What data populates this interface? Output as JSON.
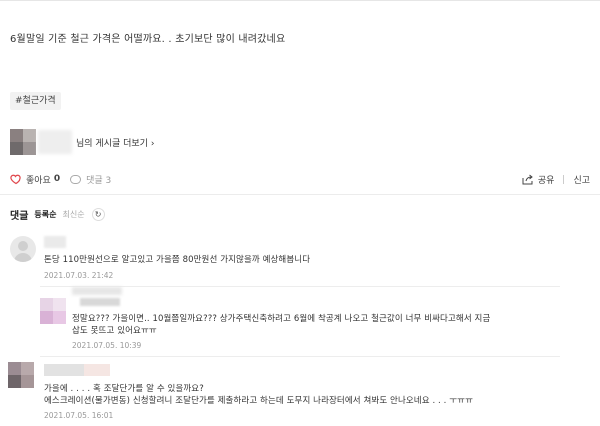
{
  "post": {
    "body": "6월말일 기준 철근 가격은 어떨까요. .   초기보단 많이 내려갔네요",
    "tag": "#철근가격",
    "author_more": "님의 게시글 더보기 ›"
  },
  "actions": {
    "like_label": "좋아요",
    "like_count": "0",
    "comment_label": "댓글 3",
    "share_label": "공유",
    "report_label": "신고"
  },
  "comments": {
    "title": "댓글",
    "sort_active": "등록순",
    "sort_inactive": "최신순",
    "refresh_glyph": "↻",
    "items": [
      {
        "text": "톤당 110만원선으로 알고있고 가을쯤 80만원선 가지않을까 예상해봅니다",
        "date": "2021.07.03.  21:42"
      },
      {
        "text_line1": "정말요??? 가을이면.. 10월쯤일까요??? 상가주택신축하려고 6월에 착공계 나오고 철근값이 너무 비싸다고해서 지금",
        "text_line2": "삽도 못뜨고 있어요ㅠㅠ",
        "date": "2021.07.05.  10:39"
      },
      {
        "text_line1": "가을에 . . . . 혹 조달단가를 알 수 있을까요?",
        "text_line2": "에스크레이션(물가변동) 신청할려니 조달단가를 제출하라고 하는데 도무지 나라장터에서 쳐봐도 안나오네요 . . . ㅜㅠㅠ",
        "date": "2021.07.05.  16:01"
      }
    ]
  },
  "colors": {
    "heart": "#e0474c",
    "text": "#333333",
    "muted": "#999999"
  }
}
